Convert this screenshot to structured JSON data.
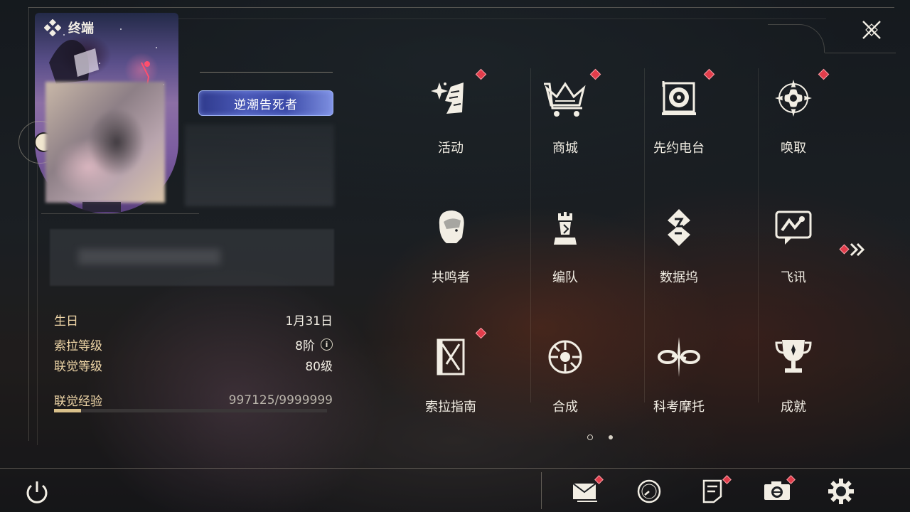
{
  "header": {
    "title": "终端"
  },
  "profile": {
    "title_badge": "逆潮告死者"
  },
  "stats": [
    {
      "label": "生日",
      "value": "1月31日"
    },
    {
      "label": "索拉等级",
      "value": "8阶"
    },
    {
      "label": "联觉等级",
      "value": "80级"
    },
    {
      "label": "联觉经验",
      "value": "997125/9999999"
    }
  ],
  "experience": {
    "current": 997125,
    "max": 9999999
  },
  "menu": [
    {
      "label": "活动",
      "icon": "sparkle-banner-icon",
      "notify": true
    },
    {
      "label": "商城",
      "icon": "crown-cart-icon",
      "notify": true
    },
    {
      "label": "先约电台",
      "icon": "radio-disc-icon",
      "notify": true
    },
    {
      "label": "唤取",
      "icon": "compass-star-icon",
      "notify": true
    },
    {
      "label": "共鸣者",
      "icon": "character-portrait-icon",
      "notify": false
    },
    {
      "label": "编队",
      "icon": "chess-tower-icon",
      "notify": false
    },
    {
      "label": "数据坞",
      "icon": "data-dock-icon",
      "notify": false
    },
    {
      "label": "飞讯",
      "icon": "chat-bubble-icon",
      "notify": false
    },
    {
      "label": "索拉指南",
      "icon": "guide-book-icon",
      "notify": true
    },
    {
      "label": "合成",
      "icon": "synthesis-ring-icon",
      "notify": false
    },
    {
      "label": "科考摩托",
      "icon": "motorcycle-icon",
      "notify": false
    },
    {
      "label": "成就",
      "icon": "trophy-icon",
      "notify": false
    }
  ],
  "pagination": {
    "current_page": 1,
    "total_pages": 2
  },
  "bottom_bar": [
    {
      "name": "mail-icon",
      "notify": true
    },
    {
      "name": "clock-icon",
      "notify": false
    },
    {
      "name": "notice-icon",
      "notify": true
    },
    {
      "name": "camera-icon",
      "notify": true
    },
    {
      "name": "settings-gear-icon",
      "notify": false
    }
  ],
  "colors": {
    "accent_label": "#f0d7a8",
    "notify_red": "#e23d4b",
    "exp_fill": "#d9c08a",
    "badge_blue": "#4a59b8"
  }
}
